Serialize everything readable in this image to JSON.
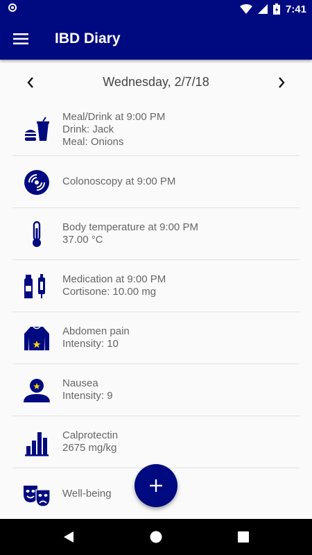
{
  "status_bar": {
    "time": "7:41"
  },
  "app_bar": {
    "title": "IBD Diary"
  },
  "date_nav": {
    "date": "Wednesday, 2/7/18"
  },
  "entries": [
    {
      "icon": "meal-drink-icon",
      "lines": [
        "Meal/Drink at 9:00 PM",
        "Drink: Jack",
        "Meal: Onions"
      ]
    },
    {
      "icon": "colonoscopy-icon",
      "lines": [
        "Colonoscopy at 9:00 PM"
      ]
    },
    {
      "icon": "thermometer-icon",
      "lines": [
        "Body temperature at 9:00 PM",
        "37.00  °C"
      ]
    },
    {
      "icon": "medication-icon",
      "lines": [
        "Medication at 9:00 PM",
        "Cortisone: 10.00 mg"
      ]
    },
    {
      "icon": "abdomen-pain-icon",
      "lines": [
        "Abdomen pain",
        "Intensity: 10"
      ]
    },
    {
      "icon": "nausea-icon",
      "lines": [
        "Nausea",
        "Intensity: 9"
      ]
    },
    {
      "icon": "calprotectin-icon",
      "lines": [
        "Calprotectin",
        "2675 mg/kg"
      ]
    },
    {
      "icon": "well-being-icon",
      "lines": [
        "Well-being"
      ]
    }
  ],
  "colors": {
    "primary": "#000a80",
    "text": "#666666",
    "background": "#fafafa"
  }
}
